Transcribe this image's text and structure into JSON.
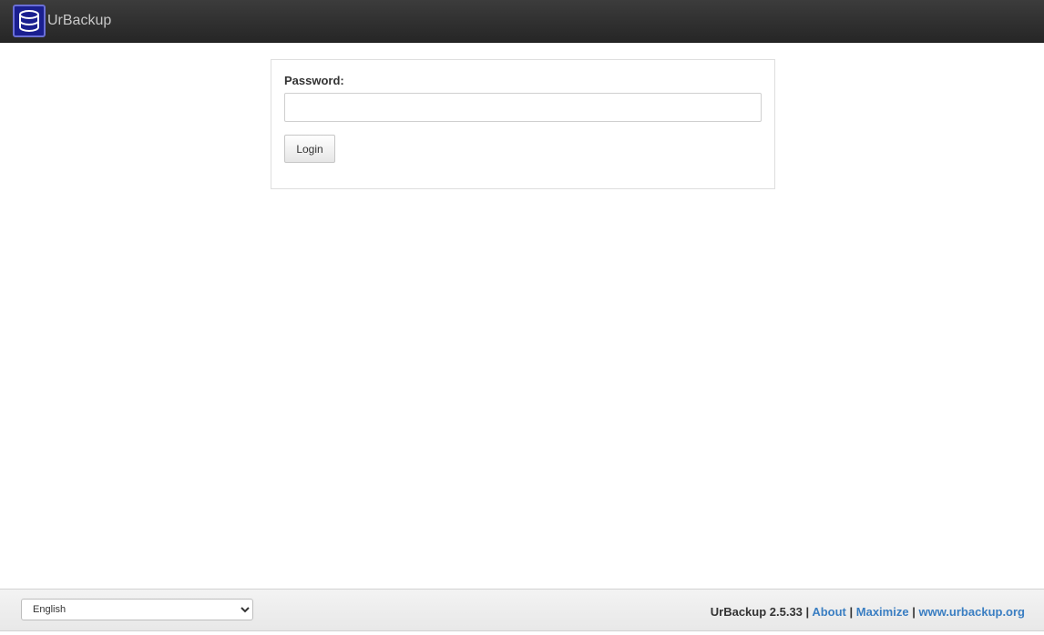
{
  "header": {
    "brand": "UrBackup",
    "logo_icon": "database-icon"
  },
  "login": {
    "password_label": "Password:",
    "password_value": "",
    "login_button": "Login"
  },
  "footer": {
    "language_selected": "English",
    "version": "UrBackup 2.5.33",
    "sep": "|",
    "about": "About",
    "maximize": "Maximize",
    "website": "www.urbackup.org"
  },
  "colors": {
    "navbar": "#2e2e2e",
    "logo_bg": "#1a1f8f",
    "link": "#3a7ec2"
  }
}
